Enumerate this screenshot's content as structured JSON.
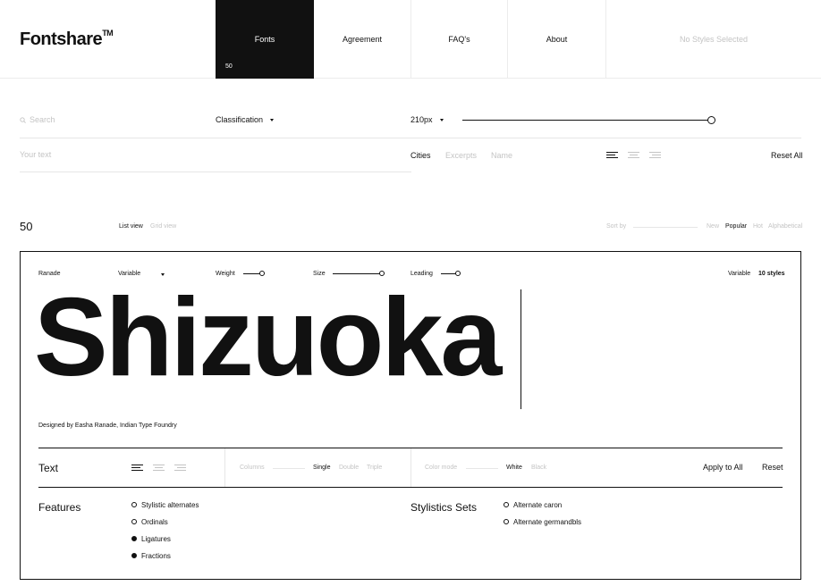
{
  "header": {
    "logo": "Fontshare",
    "logo_tm": "TM",
    "nav": [
      {
        "label": "Fonts",
        "count": "50",
        "active": true
      },
      {
        "label": "Agreement"
      },
      {
        "label": "FAQ's"
      },
      {
        "label": "About"
      }
    ],
    "styles_status": "No Styles Selected"
  },
  "filters": {
    "search_placeholder": "Search",
    "classification": "Classification",
    "size_value": "210px",
    "size_level": 1.0,
    "text_placeholder": "Your text",
    "presets": [
      "Cities",
      "Excerpts",
      "Name"
    ],
    "reset_all": "Reset All"
  },
  "listing": {
    "count": "50",
    "views": [
      "List view",
      "Grid view"
    ],
    "sort_label": "Sort by",
    "sort_options": [
      "New",
      "Popular",
      "Hot",
      "Alphabetical"
    ]
  },
  "card": {
    "font_name": "Ranade",
    "type_dropdown": "Variable",
    "weight_label": "Weight",
    "size_label": "Size",
    "leading_label": "Leading",
    "variable_label": "Variable",
    "styles_count": "10 styles",
    "specimen_text": "Shizuoka",
    "designer": "Designed by Easha Ranade, Indian Type Foundry",
    "toolbar": {
      "text_label": "Text",
      "columns_label": "Columns",
      "column_options": [
        "Single",
        "Double",
        "Triple"
      ],
      "color_mode_label": "Color mode",
      "color_options": [
        "White",
        "Black"
      ],
      "apply_all": "Apply to All",
      "reset": "Reset"
    },
    "features_title": "Features",
    "features": [
      {
        "label": "Stylistic alternates",
        "checked": false
      },
      {
        "label": "Ordinals",
        "checked": false
      },
      {
        "label": "Ligatures",
        "checked": true
      },
      {
        "label": "Fractions",
        "checked": true
      }
    ],
    "stylistic_title": "Stylistics Sets",
    "stylistic_sets": [
      {
        "label": "Alternate caron",
        "checked": false
      },
      {
        "label": "Alternate germandbls",
        "checked": false
      }
    ]
  }
}
